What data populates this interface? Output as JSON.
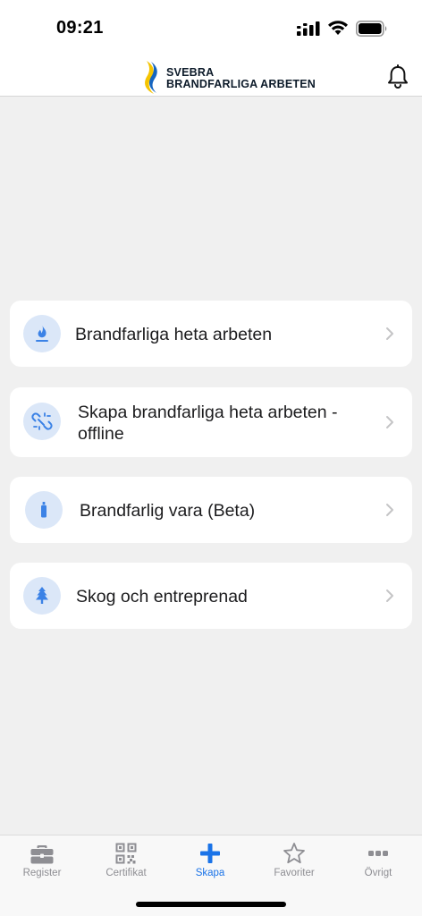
{
  "status_bar": {
    "time": "09:21",
    "icons": [
      "signal-icon",
      "wifi-icon",
      "battery-icon"
    ]
  },
  "header": {
    "logo_line1": "SVEBRA",
    "logo_line2": "BRANDFARLIGA ARBETEN",
    "bell_icon": "bell-icon"
  },
  "menu": {
    "items": [
      {
        "label": "Brandfarliga heta arbeten",
        "icon": "flame-icon"
      },
      {
        "label": "Skapa brandfarliga heta arbeten -",
        "label_line2": "offline",
        "icon": "broken-link-icon"
      },
      {
        "label": "Brandfarlig vara (Beta)",
        "icon": "gas-bottle-icon"
      },
      {
        "label": "Skog och entreprenad",
        "icon": "tree-icon"
      }
    ]
  },
  "tab_bar": {
    "tabs": [
      {
        "label": "Register",
        "icon": "briefcase-icon"
      },
      {
        "label": "Certifikat",
        "icon": "qr-code-icon"
      },
      {
        "label": "Skapa",
        "icon": "plus-icon",
        "active": true
      },
      {
        "label": "Favoriter",
        "icon": "star-icon"
      },
      {
        "label": "Övrigt",
        "icon": "more-dots-icon"
      }
    ]
  },
  "colors": {
    "accent": "#1a73e8",
    "icon_blue": "#3b82e6",
    "icon_bg": "#dbe7f8",
    "background": "#f0f0f0"
  }
}
